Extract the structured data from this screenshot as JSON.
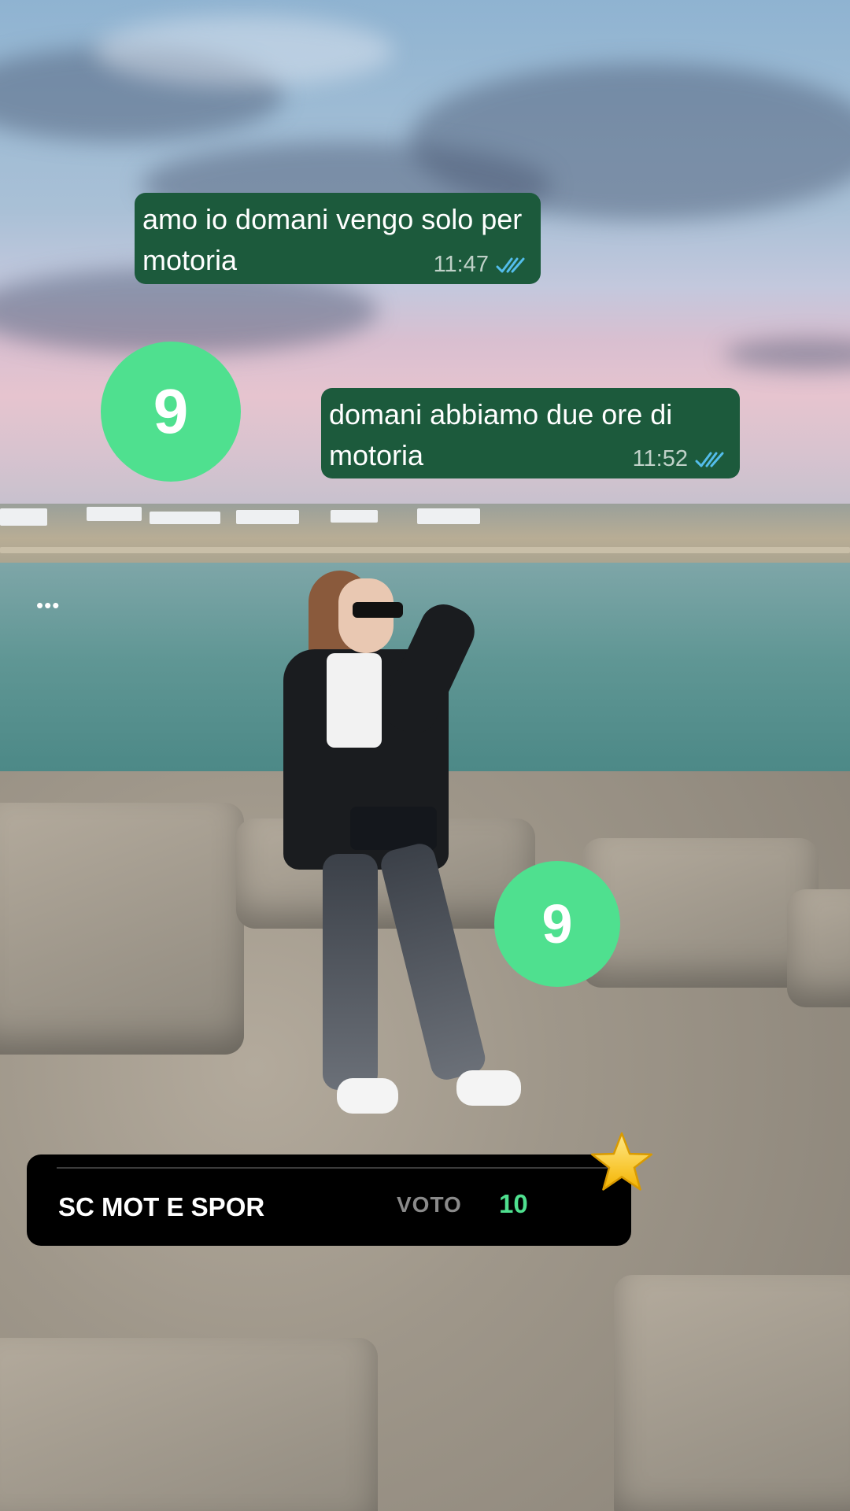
{
  "messages": [
    {
      "text": "amo io domani vengo solo per motoria",
      "time": "11:47",
      "status": "read-double-check-icon"
    },
    {
      "text": "domani abbiamo due ore di motoria",
      "time": "11:52",
      "status": "read-double-check-icon"
    }
  ],
  "badges": [
    {
      "value": "9"
    },
    {
      "value": "9"
    }
  ],
  "score_card": {
    "subject": "SC MOT E SPOR",
    "label": "VOTO",
    "value": "10",
    "icon": "star-icon"
  },
  "more_menu": {
    "glyph": "•••",
    "icon": "more-options-icon"
  },
  "colors": {
    "bubble": "#1c5a3c",
    "badge": "#4fe08f",
    "score_value": "#4fe08f",
    "score_bg": "#000000",
    "read_ticks": "#53bdeb"
  }
}
